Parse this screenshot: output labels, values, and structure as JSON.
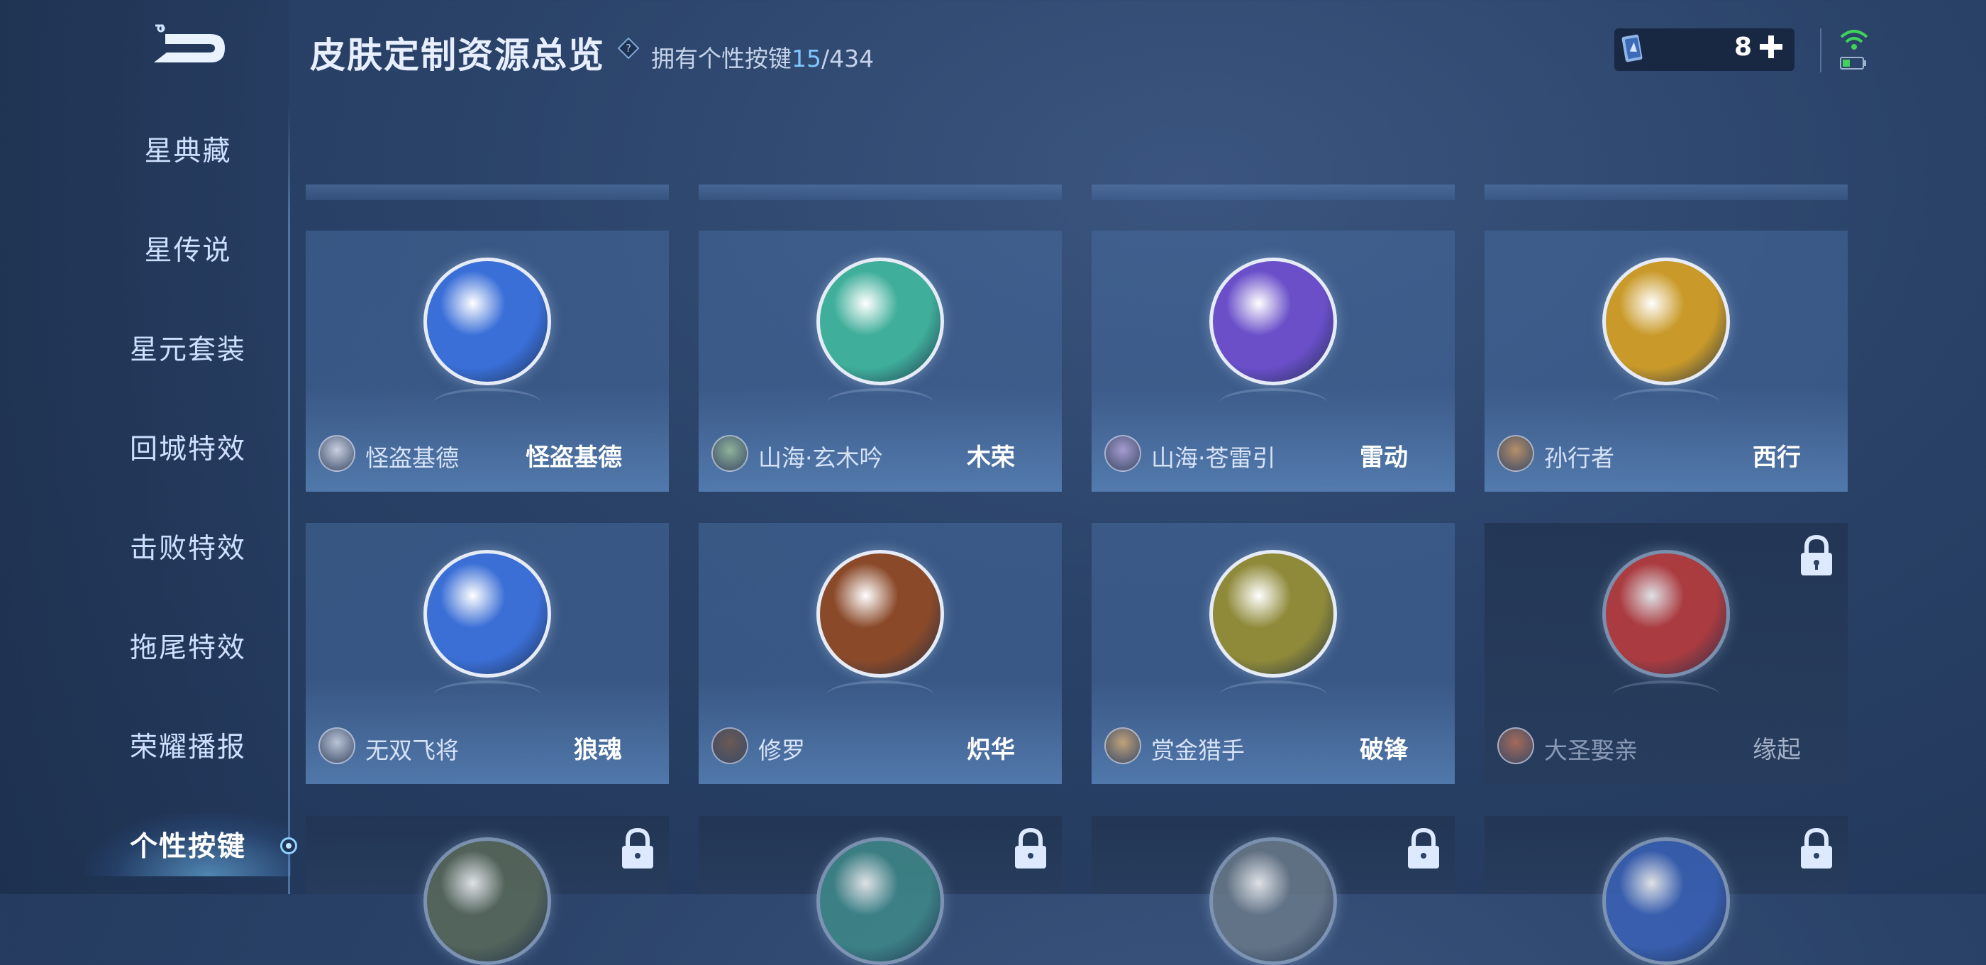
{
  "header": {
    "title": "皮肤定制资源总览",
    "owned_label": "拥有个性按键",
    "owned_count": "15",
    "owned_total": "/434"
  },
  "currency": {
    "count": "8"
  },
  "sidebar": {
    "items": [
      {
        "label": "星典藏",
        "active": false
      },
      {
        "label": "星传说",
        "active": false
      },
      {
        "label": "星元套装",
        "active": false
      },
      {
        "label": "回城特效",
        "active": false
      },
      {
        "label": "击败特效",
        "active": false
      },
      {
        "label": "拖尾特效",
        "active": false
      },
      {
        "label": "荣耀播报",
        "active": false
      },
      {
        "label": "个性按键",
        "active": true
      }
    ]
  },
  "cards": [
    {
      "hero": "怪盗基德",
      "skin": "怪盗基德",
      "locked": false,
      "emblem_color": "#3a6fd8",
      "avatar_color": "#c9cfe0"
    },
    {
      "hero": "山海·玄木吟",
      "skin": "木荣",
      "locked": false,
      "emblem_color": "#3fae9a",
      "avatar_color": "#8fb39a"
    },
    {
      "hero": "山海·苍雷引",
      "skin": "雷动",
      "locked": false,
      "emblem_color": "#6a4fc9",
      "avatar_color": "#a59bd0"
    },
    {
      "hero": "孙行者",
      "skin": "西行",
      "locked": false,
      "emblem_color": "#c99a2a",
      "avatar_color": "#b58f6a"
    },
    {
      "hero": "无双飞将",
      "skin": "狼魂",
      "locked": false,
      "emblem_color": "#3b6fd6",
      "avatar_color": "#b9c4d6"
    },
    {
      "hero": "修罗",
      "skin": "炽华",
      "locked": false,
      "emblem_color": "#8a4a2a",
      "avatar_color": "#6b5a55"
    },
    {
      "hero": "赏金猎手",
      "skin": "破锋",
      "locked": false,
      "emblem_color": "#8f8a3a",
      "avatar_color": "#c0a27a"
    },
    {
      "hero": "大圣娶亲",
      "skin": "缘起",
      "locked": true,
      "emblem_color": "#c23d3d",
      "avatar_color": "#a56a5a"
    }
  ],
  "partial_cards": [
    {
      "locked": true,
      "emblem_color": "#5a6a5a"
    },
    {
      "locked": true,
      "emblem_color": "#3f8a8a"
    },
    {
      "locked": true,
      "emblem_color": "#6a7a8a"
    },
    {
      "locked": true,
      "emblem_color": "#3a62b8"
    }
  ]
}
